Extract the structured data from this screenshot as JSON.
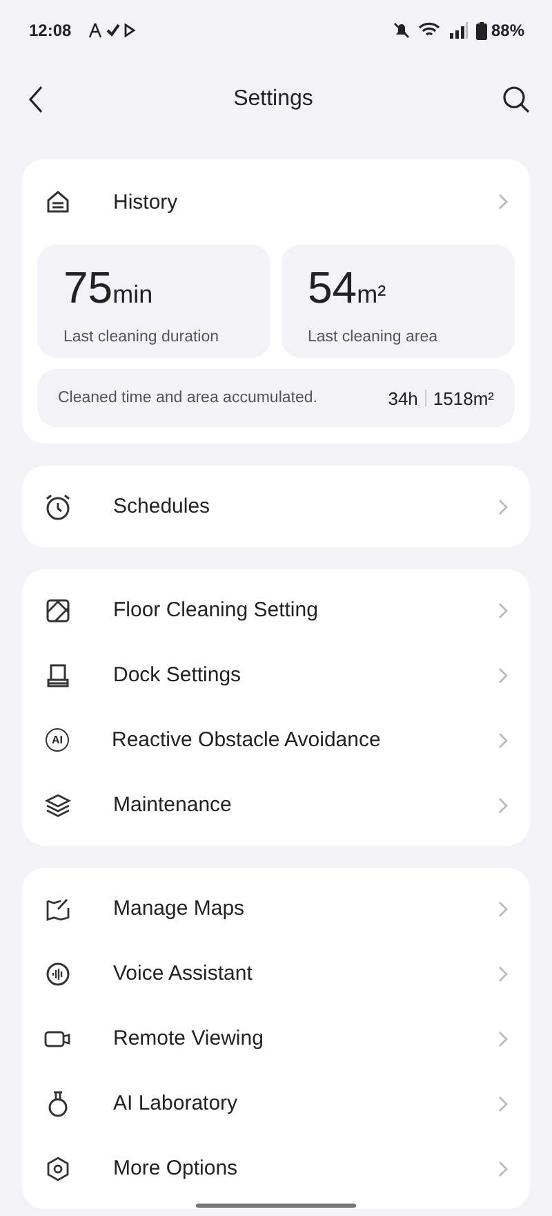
{
  "status_bar": {
    "time": "12:08",
    "battery": "88%"
  },
  "header": {
    "title": "Settings"
  },
  "history": {
    "label": "History",
    "stats": [
      {
        "value": "75",
        "unit": "min",
        "caption": "Last cleaning duration"
      },
      {
        "value": "54",
        "unit": "m²",
        "caption": "Last cleaning area"
      }
    ],
    "summary": {
      "text": "Cleaned time and area accumulated.",
      "time": "34h",
      "area": "1518m²"
    }
  },
  "groups": [
    {
      "items": [
        {
          "label": "Schedules",
          "kind": "alarm"
        }
      ]
    },
    {
      "items": [
        {
          "label": "Floor Cleaning Setting",
          "kind": "floor"
        },
        {
          "label": "Dock Settings",
          "kind": "dock"
        },
        {
          "label": "Reactive Obstacle Avoidance",
          "kind": "ai",
          "icon_text": "AI"
        },
        {
          "label": "Maintenance",
          "kind": "layers"
        }
      ]
    },
    {
      "items": [
        {
          "label": "Manage Maps",
          "kind": "map"
        },
        {
          "label": "Voice Assistant",
          "kind": "voice"
        },
        {
          "label": "Remote Viewing",
          "kind": "camera"
        },
        {
          "label": "AI Laboratory",
          "kind": "flask"
        },
        {
          "label": "More Options",
          "kind": "hexagon"
        }
      ]
    }
  ]
}
